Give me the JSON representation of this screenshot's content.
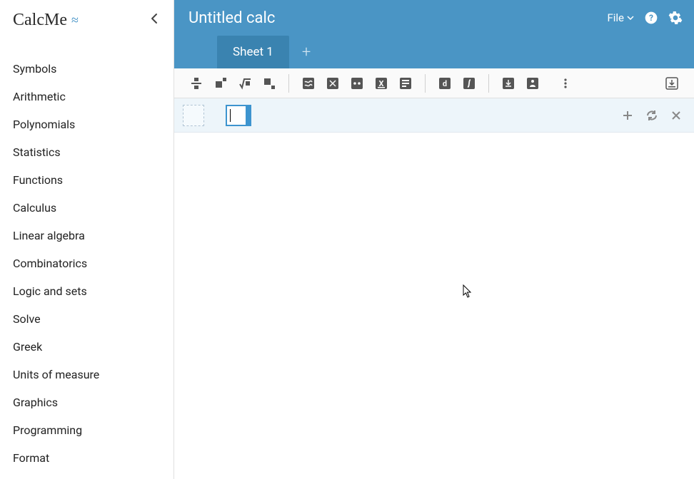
{
  "brand": "CalcMe",
  "header": {
    "title": "Untitled calc",
    "file_label": "File"
  },
  "tabs": [
    {
      "label": "Sheet 1"
    }
  ],
  "sidebar": {
    "items": [
      {
        "label": "Symbols"
      },
      {
        "label": "Arithmetic"
      },
      {
        "label": "Polynomials"
      },
      {
        "label": "Statistics"
      },
      {
        "label": "Functions"
      },
      {
        "label": "Calculus"
      },
      {
        "label": "Linear algebra"
      },
      {
        "label": "Combinatorics"
      },
      {
        "label": "Logic and sets"
      },
      {
        "label": "Solve"
      },
      {
        "label": "Greek"
      },
      {
        "label": "Units of measure"
      },
      {
        "label": "Graphics"
      },
      {
        "label": "Programming"
      },
      {
        "label": "Format"
      }
    ]
  },
  "toolbar": {
    "fraction": "fraction",
    "exponent": "exponent",
    "root": "root",
    "base": "base",
    "approx": "approx",
    "simplify": "simplify",
    "interval": "interval",
    "x_primes": "x-primes",
    "list": "list",
    "derive": "derive",
    "integral": "integral",
    "download": "download",
    "share": "share",
    "more": "more",
    "expand": "expand"
  },
  "editor": {
    "add": "add",
    "refresh": "refresh",
    "close": "close"
  }
}
